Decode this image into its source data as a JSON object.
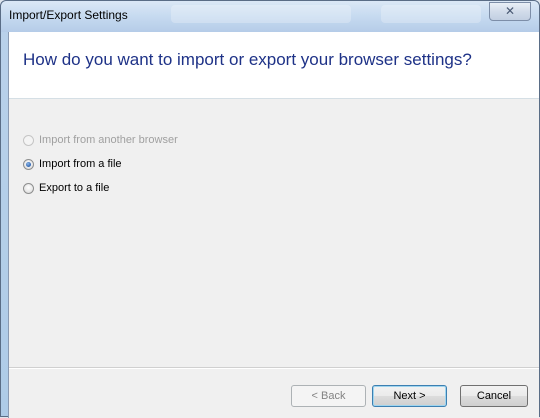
{
  "window": {
    "title": "Import/Export Settings",
    "close_glyph": "✕"
  },
  "header": {
    "heading": "How do you want to import or export your browser settings?"
  },
  "options": [
    {
      "label": "Import from another browser",
      "selected": false,
      "enabled": false
    },
    {
      "label": "Import from a file",
      "selected": true,
      "enabled": true
    },
    {
      "label": "Export to a file",
      "selected": false,
      "enabled": true
    }
  ],
  "footer": {
    "back_label": "< Back",
    "next_label": "Next >",
    "cancel_label": "Cancel"
  },
  "colors": {
    "heading": "#1e3287",
    "client_bg": "#f0f0f0",
    "header_bg": "#ffffff"
  },
  "icons": {
    "close": "close-icon",
    "radio": "radio-button"
  }
}
